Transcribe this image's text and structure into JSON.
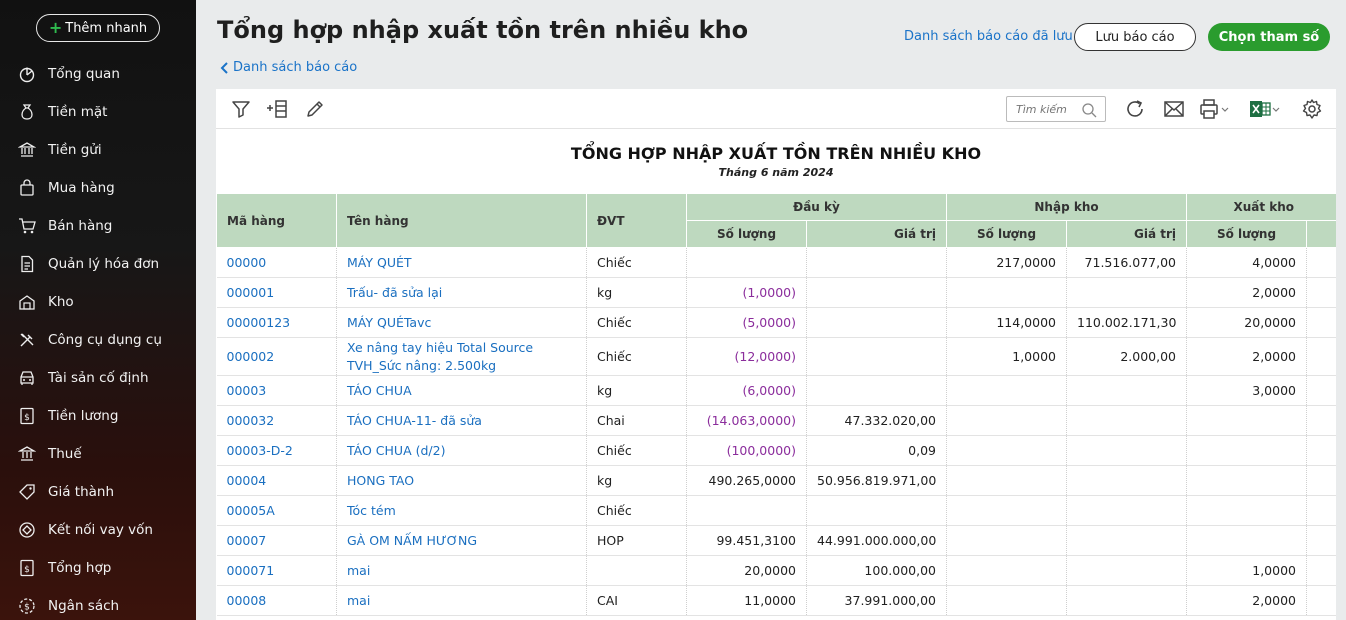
{
  "sidebar": {
    "quick_add": "Thêm nhanh",
    "items": [
      {
        "label": "Tổng quan",
        "icon": "dashboard-icon"
      },
      {
        "label": "Tiền mặt",
        "icon": "money-bag-icon"
      },
      {
        "label": "Tiền gửi",
        "icon": "bank-icon"
      },
      {
        "label": "Mua hàng",
        "icon": "shopping-bag-icon"
      },
      {
        "label": "Bán hàng",
        "icon": "cart-icon"
      },
      {
        "label": "Quản lý hóa đơn",
        "icon": "invoice-icon"
      },
      {
        "label": "Kho",
        "icon": "warehouse-icon"
      },
      {
        "label": "Công cụ dụng cụ",
        "icon": "tools-icon"
      },
      {
        "label": "Tài sản cố định",
        "icon": "car-icon"
      },
      {
        "label": "Tiền lương",
        "icon": "payroll-icon"
      },
      {
        "label": "Thuế",
        "icon": "tax-icon"
      },
      {
        "label": "Giá thành",
        "icon": "price-tag-icon"
      },
      {
        "label": "Kết nối vay vốn",
        "icon": "loan-icon"
      },
      {
        "label": "Tổng hợp",
        "icon": "summary-icon"
      },
      {
        "label": "Ngân sách",
        "icon": "budget-icon"
      }
    ]
  },
  "header": {
    "title": "Tổng hợp nhập xuất tồn trên nhiều kho",
    "back_link": "Danh sách báo cáo",
    "saved_reports": "Danh sách báo cáo đã lưu",
    "save_button": "Lưu báo cáo",
    "params_button": "Chọn tham số"
  },
  "toolbar": {
    "search_placeholder": "Tìm kiếm"
  },
  "report": {
    "title": "TỔNG HỢP NHẬP XUẤT TỒN TRÊN NHIỀU KHO",
    "subtitle": "Tháng 6 năm 2024",
    "headers": {
      "code": "Mã hàng",
      "name": "Tên hàng",
      "unit": "ĐVT",
      "opening": "Đầu kỳ",
      "import": "Nhập kho",
      "export": "Xuất kho",
      "qty": "Số lượng",
      "value": "Giá trị"
    },
    "rows": [
      {
        "code": "00000",
        "name": "MÁY QUÉT",
        "unit": "Chiếc",
        "open_qty": "",
        "open_val": "",
        "in_qty": "217,0000",
        "in_val": "71.516.077,00",
        "out_qty": "4,0000"
      },
      {
        "code": "000001",
        "name": "Trấu- đã sửa lại",
        "unit": "kg",
        "open_qty": "(1,0000)",
        "open_val": "",
        "in_qty": "",
        "in_val": "",
        "out_qty": "2,0000"
      },
      {
        "code": "00000123",
        "name": "MÁY QUÉTavc",
        "unit": "Chiếc",
        "open_qty": "(5,0000)",
        "open_val": "",
        "in_qty": "114,0000",
        "in_val": "110.002.171,30",
        "out_qty": "20,0000"
      },
      {
        "code": "000002",
        "name": "Xe nâng tay hiệu Total Source TVH_Sức nâng: 2.500kg",
        "unit": "Chiếc",
        "open_qty": "(12,0000)",
        "open_val": "",
        "in_qty": "1,0000",
        "in_val": "2.000,00",
        "out_qty": "2,0000"
      },
      {
        "code": "00003",
        "name": "TÁO CHUA",
        "unit": "kg",
        "open_qty": "(6,0000)",
        "open_val": "",
        "in_qty": "",
        "in_val": "",
        "out_qty": "3,0000"
      },
      {
        "code": "000032",
        "name": "TÁO CHUA-11- đã sửa",
        "unit": "Chai",
        "open_qty": "(14.063,0000)",
        "open_val": "47.332.020,00",
        "in_qty": "",
        "in_val": "",
        "out_qty": ""
      },
      {
        "code": "00003-D-2",
        "name": "TÁO CHUA (d/2)",
        "unit": "Chiếc",
        "open_qty": "(100,0000)",
        "open_val": "0,09",
        "in_qty": "",
        "in_val": "",
        "out_qty": ""
      },
      {
        "code": "00004",
        "name": "HONG TAO",
        "unit": "kg",
        "open_qty": "490.265,0000",
        "open_val": "50.956.819.971,00",
        "in_qty": "",
        "in_val": "",
        "out_qty": ""
      },
      {
        "code": "00005A",
        "name": "Tóc tém",
        "unit": "Chiếc",
        "open_qty": "",
        "open_val": "",
        "in_qty": "",
        "in_val": "",
        "out_qty": ""
      },
      {
        "code": "00007",
        "name": "GÀ OM NẤM HƯƠNG",
        "unit": "HOP",
        "open_qty": "99.451,3100",
        "open_val": "44.991.000.000,00",
        "in_qty": "",
        "in_val": "",
        "out_qty": ""
      },
      {
        "code": "000071",
        "name": "mai",
        "unit": "",
        "open_qty": "20,0000",
        "open_val": "100.000,00",
        "in_qty": "",
        "in_val": "",
        "out_qty": "1,0000"
      },
      {
        "code": "00008",
        "name": "mai",
        "unit": "CAI",
        "open_qty": "11,0000",
        "open_val": "37.991.000,00",
        "in_qty": "",
        "in_val": "",
        "out_qty": "2,0000"
      }
    ]
  }
}
